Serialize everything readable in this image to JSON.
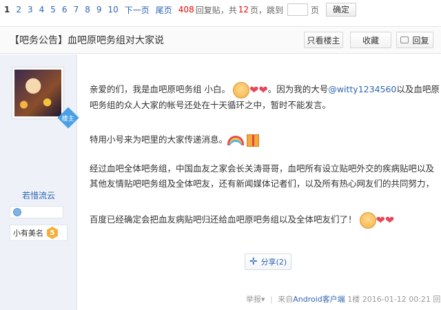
{
  "pager": {
    "pages": [
      "1",
      "2",
      "3",
      "4",
      "5",
      "6",
      "7",
      "8",
      "9",
      "10"
    ],
    "current": "1",
    "next": "下一页",
    "last": "尾页",
    "reply_count": "408",
    "reply_label": "回复贴，共",
    "page_count": "12",
    "page_label": "页，跳到",
    "page_suffix": "页",
    "confirm": "确定"
  },
  "thread": {
    "title": "【吧务公告】血吧原吧务组对大家说",
    "only_owner": "只看楼主",
    "favorite": "收藏",
    "reply": "回复"
  },
  "user": {
    "badge": "楼主",
    "name": "若惜流云",
    "rank_label": "小有美名",
    "rank_level": "5"
  },
  "post": {
    "p1_a": "亲爱的们，我是血吧原吧务组 小白。",
    "p1_b": "。因为我的大号",
    "p1_link": "@witty1234560",
    "p1_c": "以及血吧原",
    "p1_line2": "吧务组的众人大家的帐号还处在十天循环之中，暂时不能发言。",
    "p2": "特用小号来为吧里的大家传递消息。",
    "p3_line1": "经过血吧全体吧务组，中国血友之家会长关涛哥哥，血吧所有设立贴吧外交的疾病贴吧以及",
    "p3_line2": "其他友情贴吧吧务组及全体吧友，还有新闻媒体记者们，以及所有热心网友们的共同努力，",
    "p4": "百度已经确定会把血友病贴吧归还给血吧原吧务组以及全体吧友们了！"
  },
  "share": {
    "label": "分享",
    "count": "(2)"
  },
  "footer": {
    "report": "举报",
    "from": "来自",
    "client": "Android客户端",
    "floor": "1楼",
    "time": "2016-01-12 00:21",
    "reply": "回复"
  }
}
